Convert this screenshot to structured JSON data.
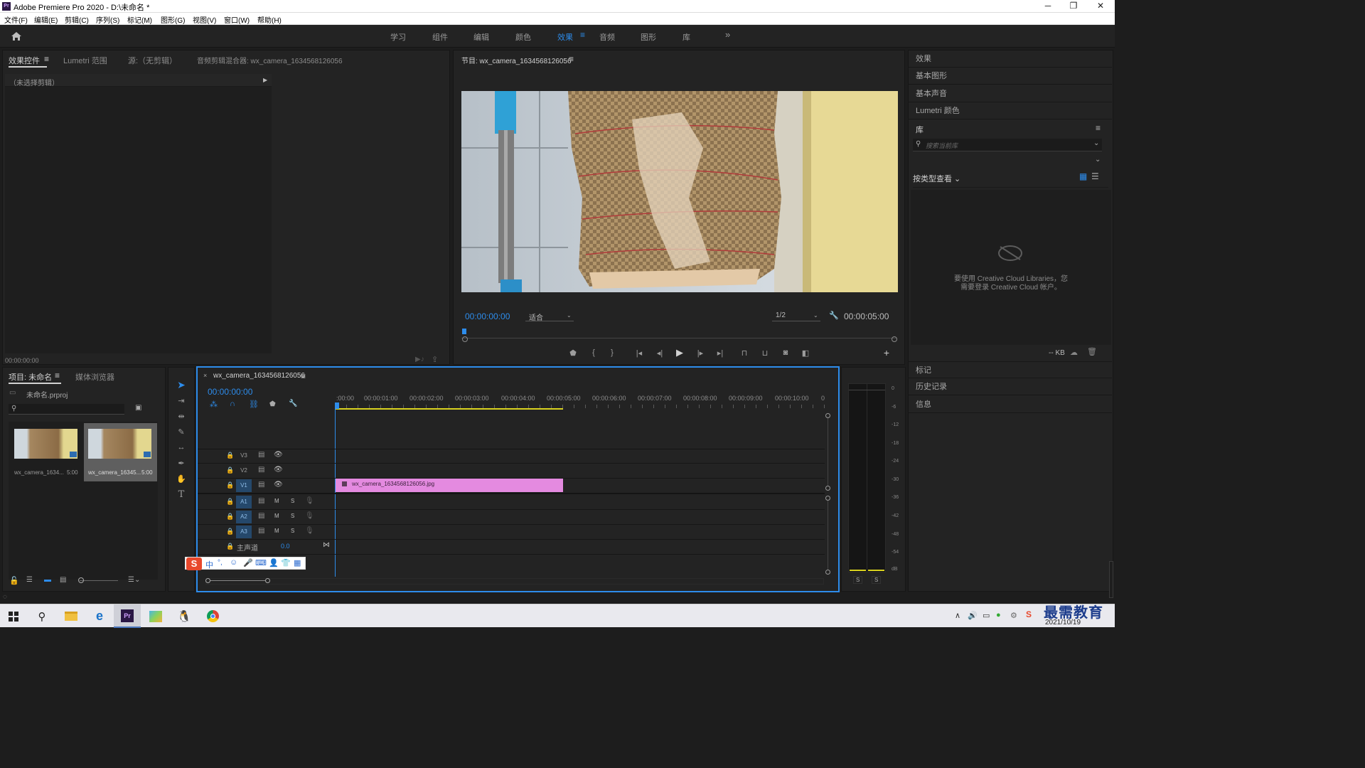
{
  "window": {
    "title": "Adobe Premiere Pro 2020 - D:\\未命名 *",
    "app_icon_label": "Pr"
  },
  "menu": [
    "文件(F)",
    "编辑(E)",
    "剪辑(C)",
    "序列(S)",
    "标记(M)",
    "图形(G)",
    "视图(V)",
    "窗口(W)",
    "帮助(H)"
  ],
  "workspaces": [
    "学习",
    "组件",
    "编辑",
    "颜色",
    "效果",
    "音频",
    "图形",
    "库"
  ],
  "active_workspace": "效果",
  "left_top": {
    "tabs": [
      "效果控件",
      "Lumetri 范围",
      "源:（无剪辑）",
      "音频剪辑混合器: wx_camera_1634568126056"
    ],
    "no_clip": "（未选择剪辑）",
    "timecode": "00:00:00:00"
  },
  "program": {
    "title": "节目: wx_camera_1634568126056",
    "timecode": "00:00:00:00",
    "fit": "适合",
    "resolution": "1/2",
    "duration": "00:00:05:00"
  },
  "project": {
    "tabs": [
      "项目: 未命名",
      "媒体浏览器"
    ],
    "file": "未命名.prproj",
    "items": [
      {
        "name": "wx_camera_1634...",
        "dur": "5:00"
      },
      {
        "name": "wx_camera_16345...",
        "dur": "5:00"
      }
    ]
  },
  "timeline": {
    "tab": "wx_camera_1634568126056",
    "timecode": "00:00:00:00",
    "ruler": [
      ":00:00",
      "00:00:01:00",
      "00:00:02:00",
      "00:00:03:00",
      "00:00:04:00",
      "00:00:05:00",
      "00:00:06:00",
      "00:00:07:00",
      "00:00:08:00",
      "00:00:09:00",
      "00:00:10:00",
      "0"
    ],
    "video_tracks": [
      "V3",
      "V2",
      "V1"
    ],
    "audio_tracks": [
      "A1",
      "A2",
      "A3"
    ],
    "master": {
      "label": "主声道",
      "value": "0.0"
    },
    "clip": {
      "name": "wx_camera_1634568126056.jpg",
      "color": "#e48ae0"
    },
    "m": "M",
    "s": "S"
  },
  "meter": {
    "scale": [
      "0",
      "-6",
      "-12",
      "-18",
      "-24",
      "-30",
      "-36",
      "-42",
      "-48",
      "-54",
      "dB"
    ],
    "solo": [
      "S",
      "S"
    ]
  },
  "right_panel": {
    "items": [
      "效果",
      "基本图形",
      "基本声音",
      "Lumetri 颜色"
    ],
    "library": "库",
    "search_placeholder": "搜索当前库",
    "view_by": "按类型查看",
    "cc_msg_1": "要使用 Creative Cloud Libraries，您",
    "cc_msg_2": "需要登录 Creative Cloud 帐户。",
    "kb": "-- KB",
    "bottom_items": [
      "标记",
      "历史记录",
      "信息"
    ]
  },
  "ime": {
    "label": "中",
    "extra": "°,"
  },
  "taskbar": {
    "watermark": "最需教育",
    "date": "2021/10/19"
  },
  "colors": {
    "accent": "#2d8ceb",
    "clip": "#e48ae0",
    "yellow": "#d9d21f"
  }
}
